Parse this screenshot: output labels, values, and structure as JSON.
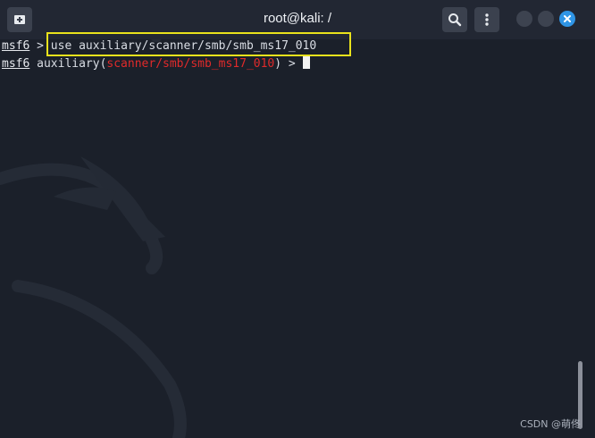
{
  "window": {
    "title": "root@kali: /"
  },
  "titlebar": {
    "new_tab_icon": "new-tab-icon",
    "search_icon": "search-icon",
    "menu_icon": "menu-icon",
    "close_icon": "close-icon"
  },
  "terminal": {
    "line1": {
      "prompt": "msf6",
      "separator": " > ",
      "command": "use auxiliary/scanner/smb/smb_ms17_010"
    },
    "line2": {
      "prompt": "msf6",
      "module_prefix": " auxiliary(",
      "module_path": "scanner/smb/smb_ms17_010",
      "module_suffix": ") > "
    }
  },
  "watermark": "CSDN @萌佟",
  "colors": {
    "background": "#1b202a",
    "titlebar": "#222733",
    "module_path": "#e02a2a",
    "highlight": "#e9e21c",
    "close_button": "#2f95e6"
  }
}
